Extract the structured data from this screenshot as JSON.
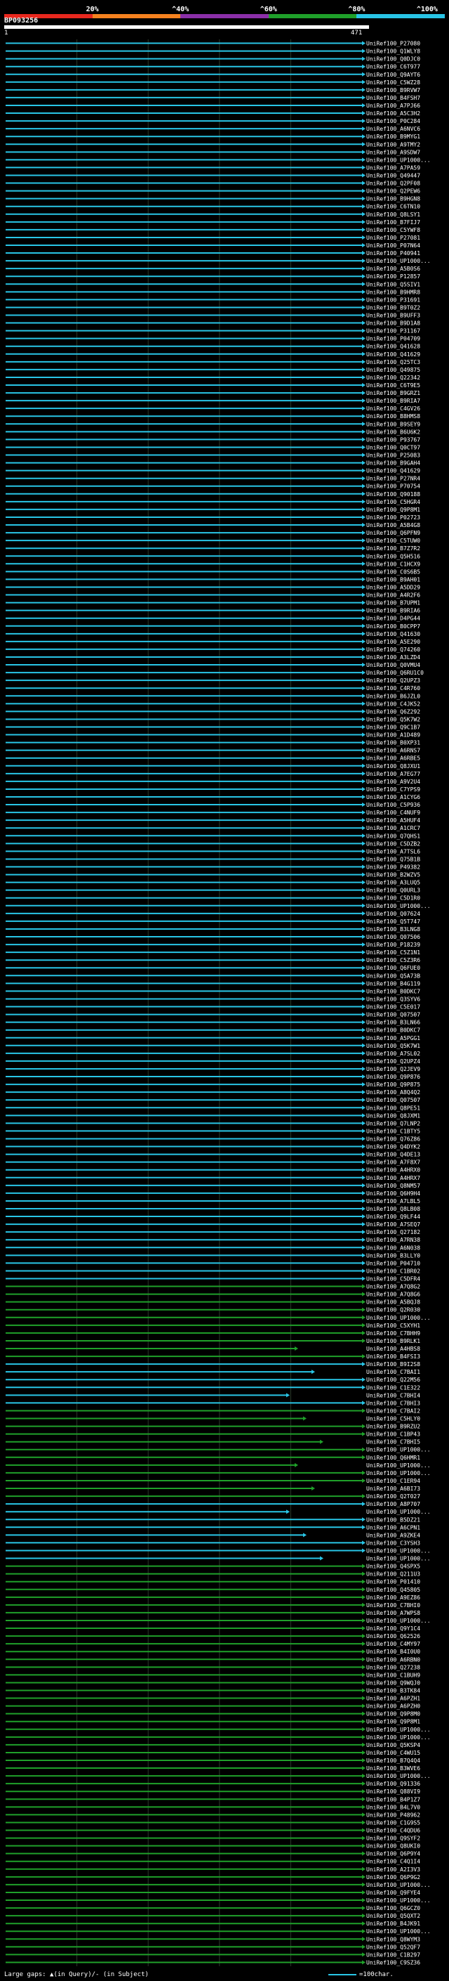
{
  "scale": {
    "ticks": [
      "20%",
      "^40%",
      "^60%",
      "^80%",
      "^100%"
    ],
    "tick_positions": [
      0.2,
      0.4,
      0.6,
      0.8,
      1.0
    ],
    "colors": [
      "#e8281e",
      "#f5821f",
      "#8b2fa8",
      "#1fa02a",
      "#29c5e6"
    ]
  },
  "query": {
    "title": "BP093256",
    "range_start": "1",
    "range_end": "471"
  },
  "hits": {
    "label_prefix": "UniRef100_",
    "ids": [
      "P27080",
      "Q1WLY8",
      "Q0DJC0",
      "C6T977",
      "Q9AYT6",
      "C5WZ28",
      "B9RVW7",
      "B4FSH7",
      "A7PJ66",
      "A5C3H2",
      "P0C284",
      "A6NVC6",
      "B9MYG1",
      "A9TMY2",
      "A9SDW7",
      "UP1000...",
      "A7PA59",
      "Q49447",
      "Q2PF08",
      "Q2PEW6",
      "B9HGN8",
      "C6TN10",
      "Q8LSY1",
      "B7FIJ7",
      "C5YWF8",
      "P27081",
      "P07N64",
      "P40941",
      "UP1000...",
      "A5B0S6",
      "P12857",
      "Q5SIV1",
      "B9HMR8",
      "P31691",
      "B9T0Z2",
      "B9UFF3",
      "B9D1A8",
      "P31167",
      "P04709",
      "Q41628",
      "Q41629",
      "Q25TC3",
      "Q49875",
      "Q22342",
      "C6T9E5",
      "B9GRZ1",
      "B9RIA7",
      "C4GV26",
      "B8HMS8",
      "B9SEY9",
      "B6U6K2",
      "P93767",
      "Q0CT97",
      "P25083",
      "B9GAH4",
      "Q41629",
      "P27NR4",
      "P70754",
      "Q90188",
      "C5HGR4",
      "Q9P8M1",
      "P02723",
      "A5B4G8",
      "Q6PFN9",
      "C5TUW0",
      "B7Z7R2",
      "Q5H516",
      "C1HCX9",
      "C0S6B5",
      "B9AH01",
      "A5DD29",
      "A4R2F6",
      "B7UPM1",
      "B9RIA6",
      "D4PG44",
      "B0CPP7",
      "Q41630",
      "A5E290",
      "Q74260",
      "A3LZD4",
      "Q0VMU4",
      "Q6RU1C0",
      "Q2UPZ3",
      "C4R760",
      "B6JZL0",
      "C4JK52",
      "Q6Z292",
      "Q5K7W2",
      "Q9C1B7",
      "A1D489",
      "B0XP31",
      "A6RNS7",
      "A6RBE5",
      "Q8JXU1",
      "A7EG77",
      "A9V2U4",
      "C7YPS9",
      "A1CYG6",
      "C5P936",
      "C4NUF9",
      "A5HUF4",
      "A1CRC7",
      "Q7QHS1",
      "C5DZB2",
      "A7TSL6",
      "Q75B1B",
      "P49382",
      "B2WZV5",
      "A3LUQ5",
      "Q0URL3",
      "C5D1R0",
      "UP1000...",
      "Q07624",
      "Q5T747",
      "B3LNG8",
      "Q07506",
      "P18239",
      "C5Z1N1",
      "C5Z3R6",
      "Q6FUE0",
      "Q5A73B",
      "B4G119",
      "B0DKC7",
      "Q3SYV6",
      "C5E017",
      "Q07507",
      "B3LN66",
      "B0DKC7",
      "A5PGG1",
      "Q5K7W1",
      "A7SL02",
      "Q2UPZ4",
      "Q2JEV9",
      "Q9P876",
      "Q9P875",
      "A8Q4Q2",
      "Q07507",
      "Q8PE51",
      "Q8JXM1",
      "Q7LNP2",
      "C1BTY5",
      "Q76Z86",
      "Q4DYK2",
      "Q4DE13",
      "A7F8X7",
      "A4HRX0",
      "A4HRX7",
      "Q8NM57",
      "Q6H9H4",
      "A7LBL5",
      "Q8LB08",
      "Q9LF44",
      "A7SEQ7",
      "Q27182",
      "A7RN38",
      "A6N038",
      "B3LLY0",
      "P04710",
      "C1BR02",
      "C5DFR4",
      "A7Q8G2",
      "A7Q8G6",
      "A5BQJ8",
      "Q2R030",
      "UP1000...",
      "C5XYH1",
      "C7BHH9",
      "B9RLK1",
      "A4HBS8",
      "B4FSI3",
      "B9I2S8",
      "C7BAI1",
      "Q22M56",
      "C1E322",
      "C7BHI4",
      "C7BHI3",
      "C7BAI2",
      "C5HLY0",
      "B9RZU2",
      "C1BP43",
      "C7BHI5",
      "UP1000...",
      "Q6HMR1",
      "UP1000...",
      "UP1000...",
      "C1ER94",
      "A6BI73",
      "Q2T027",
      "A8P707",
      "UP1000...",
      "B5DZ21",
      "A6CPN1",
      "A9ZKE4",
      "C3YSH3",
      "UP1000...",
      "UP1000...",
      "Q4SPX5",
      "Q211U3",
      "P01410",
      "Q45805",
      "A9EZ86",
      "C7BHI0",
      "A7WPS8",
      "UP1000...",
      "Q9Y1C4",
      "Q62526",
      "C4MY97",
      "B4I0U0",
      "A6RBN0",
      "Q27238",
      "C1BUH9",
      "Q9WQJ0",
      "B3TK84",
      "A6PZH1",
      "A6PZH0",
      "Q9P8M0",
      "Q9P8M1",
      "UP1000...",
      "UP1000...",
      "Q5KSP4",
      "C4WU15",
      "B7Q4Q4",
      "B3WVE6",
      "UP1000...",
      "Q91336",
      "Q88VI9",
      "B4P1Z7",
      "B4L7V0",
      "P48962",
      "C1G9S5",
      "C4QDU6",
      "Q9SYF2",
      "Q8UKI0",
      "Q6P9Y4",
      "C4Q1I4",
      "A2I3V3",
      "Q6P9G2",
      "UP1000...",
      "Q9FYE4",
      "UP1000...",
      "Q6GCZ0",
      "Q5QXT2",
      "B4JK91",
      "UP1000...",
      "Q8WYM3",
      "Q52QF7",
      "C1B297",
      "C9SZ36"
    ]
  },
  "footer": {
    "gap_label": "Large gaps: ▲(in Query)/- (in Subject)",
    "scale_label": "=100char."
  }
}
